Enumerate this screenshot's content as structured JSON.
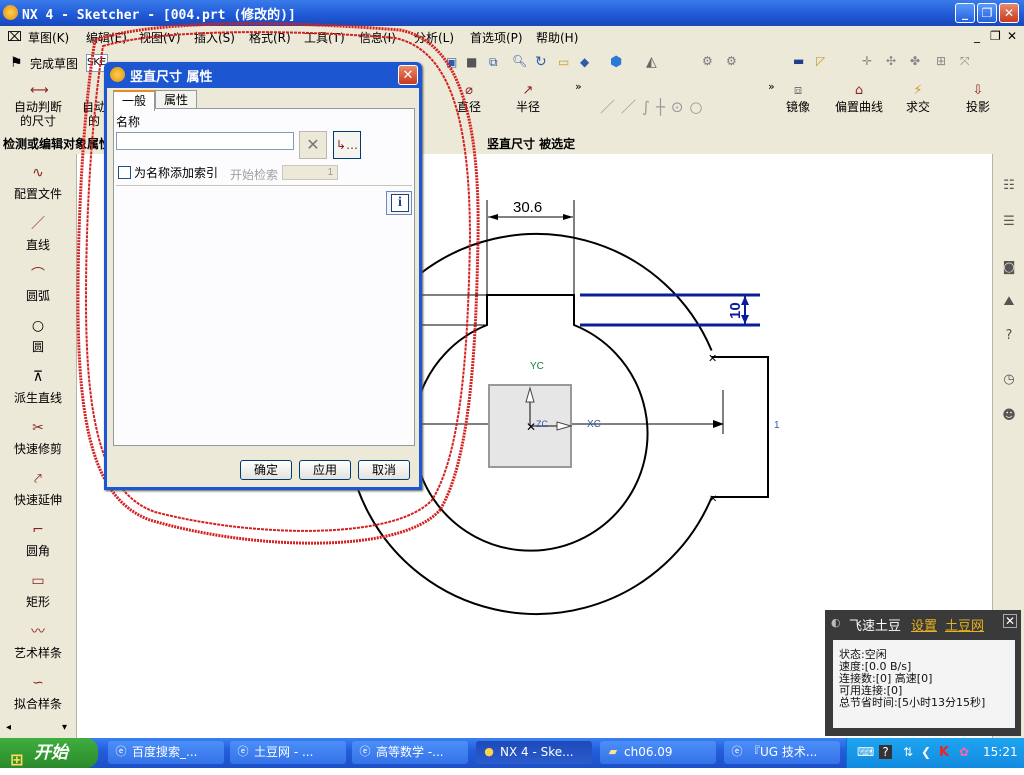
{
  "window": {
    "title": "NX 4 - Sketcher - [004.prt (修改的)]"
  },
  "menubar": [
    "草图(K)",
    "编辑(E)",
    "视图(V)",
    "插入(S)",
    "格式(R)",
    "工具(T)",
    "信息(I)",
    "分析(L)",
    "首选项(P)",
    "帮助(H)"
  ],
  "toolbar1": {
    "finish_label": "完成草图",
    "sketch_field": "SKE"
  },
  "toolbar2": {
    "auto_dim_label_1": "自动判断",
    "auto_dim_label_2": "的尺寸",
    "auto_cut_1": "自动",
    "auto_cut_2": "的",
    "diameter": "直径",
    "radius": "半径",
    "mirror": "镜像",
    "offset_curve": "偏置曲线",
    "intersect": "求交",
    "project": "投影"
  },
  "statusrow": {
    "left": "检测或编辑对象属性",
    "center": "竖直尺寸 被选定"
  },
  "left_palette": [
    "配置文件",
    "直线",
    "圆弧",
    "圆",
    "派生直线",
    "快速修剪",
    "快速延伸",
    "圆角",
    "矩形",
    "艺术样条",
    "拟合样条"
  ],
  "dialog": {
    "title": "竖直尺寸 属性",
    "tabs": [
      "一般",
      "属性"
    ],
    "name_label": "名称",
    "name_value": "",
    "index_checkbox_label": "为名称添加索引",
    "start_label": "开始检索",
    "start_value": "1",
    "ok": "确定",
    "apply": "应用",
    "cancel": "取消"
  },
  "sketch": {
    "dim_horizontal": "30.6",
    "dim_vertical": "10",
    "label_yc": "YC",
    "label_xc": "XC",
    "label_zc": "ZC",
    "label_one": "1"
  },
  "popup": {
    "title": "飞速土豆",
    "settings_link": "设置",
    "site_link": "土豆网",
    "lines": [
      "状态:空闲",
      "速度:[0.0 B/s]",
      "连接数:[0] 高速[0]",
      "可用连接:[0]",
      "总节省时间:[5小时13分15秒]"
    ]
  },
  "taskbar": {
    "start": "开始",
    "tasks": [
      "百度搜索_...",
      "土豆网 - ...",
      "高等数学 -...",
      "NX 4 - Ske...",
      "ch06.09",
      "『UG 技术..."
    ],
    "clock": "15:21"
  },
  "colors": {
    "xp_blue": "#245edb",
    "dialog_blue": "#1c56d0",
    "annotation_red": "#d42020",
    "dim_blue": "#0a1e9a"
  }
}
